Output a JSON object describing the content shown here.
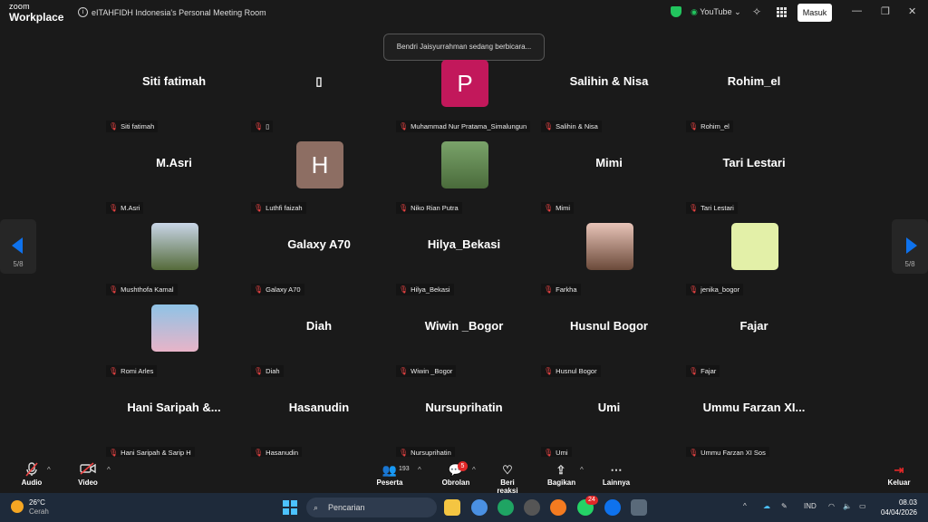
{
  "app": {
    "brand_line1": "zoom",
    "brand_line2": "Workplace",
    "meeting_title": "eITAHFIDH Indonesia's Personal Meeting Room"
  },
  "titlebar": {
    "youtube_label": "YouTube",
    "sign_in_label": "Masuk"
  },
  "speaking_banner": "Bendri Jaisyurrahman sedang berbicara...",
  "pager": {
    "left": "5/8",
    "right": "5/8"
  },
  "participants": [
    {
      "display_name": "Siti fatimah",
      "caption": "Siti fatimah",
      "kind": "name"
    },
    {
      "display_name": "▯",
      "caption": "▯",
      "kind": "name"
    },
    {
      "display_name": "",
      "caption": "Muhammad Nur Pratama_Simalungun",
      "kind": "avatar",
      "letter": "P",
      "color": "#c2185b"
    },
    {
      "display_name": "Salihin & Nisa",
      "caption": "Salihin & Nisa",
      "kind": "name"
    },
    {
      "display_name": "Rohim_el",
      "caption": "Rohim_el",
      "kind": "name"
    },
    {
      "display_name": "M.Asri",
      "caption": "M.Asri",
      "kind": "name"
    },
    {
      "display_name": "",
      "caption": "Luthfi faizah",
      "kind": "avatar",
      "letter": "H",
      "color": "#8d6e63"
    },
    {
      "display_name": "",
      "caption": "Niko Rian Putra",
      "kind": "photo",
      "photo_colors": [
        "#7aa36a",
        "#4a6b3b"
      ]
    },
    {
      "display_name": "Mimi",
      "caption": "Mimi",
      "kind": "name"
    },
    {
      "display_name": "Tari Lestari",
      "caption": "Tari Lestari",
      "kind": "name"
    },
    {
      "display_name": "",
      "caption": "Mushthofa Kamal",
      "kind": "photo",
      "photo_colors": [
        "#c9d6e8",
        "#556b3a"
      ]
    },
    {
      "display_name": "Galaxy A70",
      "caption": "Galaxy A70",
      "kind": "name"
    },
    {
      "display_name": "Hilya_Bekasi",
      "caption": "Hilya_Bekasi",
      "kind": "name"
    },
    {
      "display_name": "",
      "caption": "Farkha",
      "kind": "photo",
      "photo_colors": [
        "#e8c4b8",
        "#6b4a3a"
      ]
    },
    {
      "display_name": "",
      "caption": "jenika_bogor",
      "kind": "avatar",
      "letter": "",
      "color": "#e3f0a8"
    },
    {
      "display_name": "",
      "caption": "Romi Arles",
      "kind": "photo",
      "photo_colors": [
        "#8fc3e6",
        "#e8b4c8"
      ]
    },
    {
      "display_name": "Diah",
      "caption": "Diah",
      "kind": "name"
    },
    {
      "display_name": "Wiwin _Bogor",
      "caption": "Wiwin _Bogor",
      "kind": "name"
    },
    {
      "display_name": "Husnul Bogor",
      "caption": "Husnul Bogor",
      "kind": "name"
    },
    {
      "display_name": "Fajar",
      "caption": "Fajar",
      "kind": "name"
    },
    {
      "display_name": "Hani Saripah &...",
      "caption": "Hani Saripah & Sarip H",
      "kind": "name"
    },
    {
      "display_name": "Hasanudin",
      "caption": "Hasanudin",
      "kind": "name"
    },
    {
      "display_name": "Nursuprihatin",
      "caption": "Nursuprihatin",
      "kind": "name"
    },
    {
      "display_name": "Umi",
      "caption": "Umi",
      "kind": "name"
    },
    {
      "display_name": "Ummu Farzan XI...",
      "caption": "Ummu Farzan XI Sos",
      "kind": "name"
    }
  ],
  "toolbar": {
    "audio": "Audio",
    "video": "Video",
    "participants": "Peserta",
    "participants_count": "193",
    "chat": "Obrolan",
    "chat_badge": "5",
    "react": "Beri reaksi",
    "share": "Bagikan",
    "more": "Lainnya",
    "leave": "Keluar"
  },
  "taskbar": {
    "temperature": "26°C",
    "weather": "Cerah",
    "search_placeholder": "Pencarian",
    "whatsapp_badge": "24",
    "language": "IND",
    "time": "08.03",
    "date": "04/04/2026"
  },
  "colors": {
    "background": "#1a1a1a",
    "accent": "#0e72ed",
    "mute": "#ef4444",
    "leave": "#e02828"
  }
}
